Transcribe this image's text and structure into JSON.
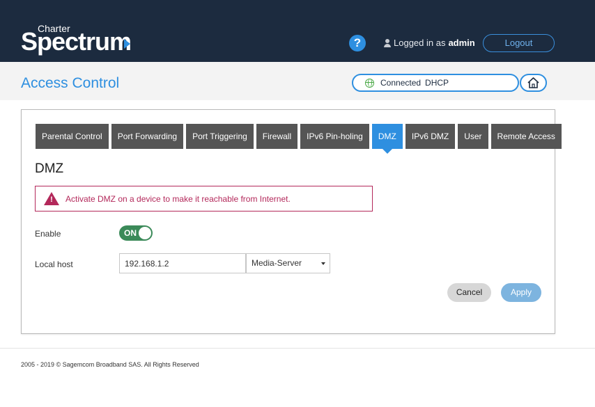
{
  "header": {
    "logo_small": "Charter",
    "logo_big": "Spectrum",
    "help_symbol": "?",
    "logged_in_prefix": "Logged in as",
    "username": "admin",
    "logout_label": "Logout"
  },
  "titlebar": {
    "page_title": "Access Control",
    "connection_status": "Connected",
    "connection_type": "DHCP"
  },
  "tabs": [
    {
      "label": "Parental Control",
      "active": false
    },
    {
      "label": "Port Forwarding",
      "active": false
    },
    {
      "label": "Port Triggering",
      "active": false
    },
    {
      "label": "Firewall",
      "active": false
    },
    {
      "label": "IPv6 Pin-holing",
      "active": false
    },
    {
      "label": "DMZ",
      "active": true
    },
    {
      "label": "IPv6 DMZ",
      "active": false
    },
    {
      "label": "User",
      "active": false
    },
    {
      "label": "Remote Access",
      "active": false
    }
  ],
  "dmz": {
    "section_title": "DMZ",
    "alert_text": "Activate DMZ on a device to make it reachable from Internet.",
    "enable_label": "Enable",
    "toggle_state": "ON",
    "local_host_label": "Local host",
    "local_host_ip": "192.168.1.2",
    "local_host_device": "Media-Server",
    "cancel_label": "Cancel",
    "apply_label": "Apply"
  },
  "footer": {
    "copyright": "2005 - 2019 © Sagemcom Broadband SAS. All Rights Reserved"
  },
  "colors": {
    "header_bg": "#1c2b3f",
    "accent": "#2e8fe0",
    "tab_bg": "#555555",
    "alert": "#b3285a",
    "toggle_on": "#3b8a59",
    "apply_bg": "#7db4df"
  },
  "icons": [
    "help-icon",
    "user-icon",
    "globe-icon",
    "home-icon",
    "warning-icon",
    "chevron-down-icon"
  ]
}
